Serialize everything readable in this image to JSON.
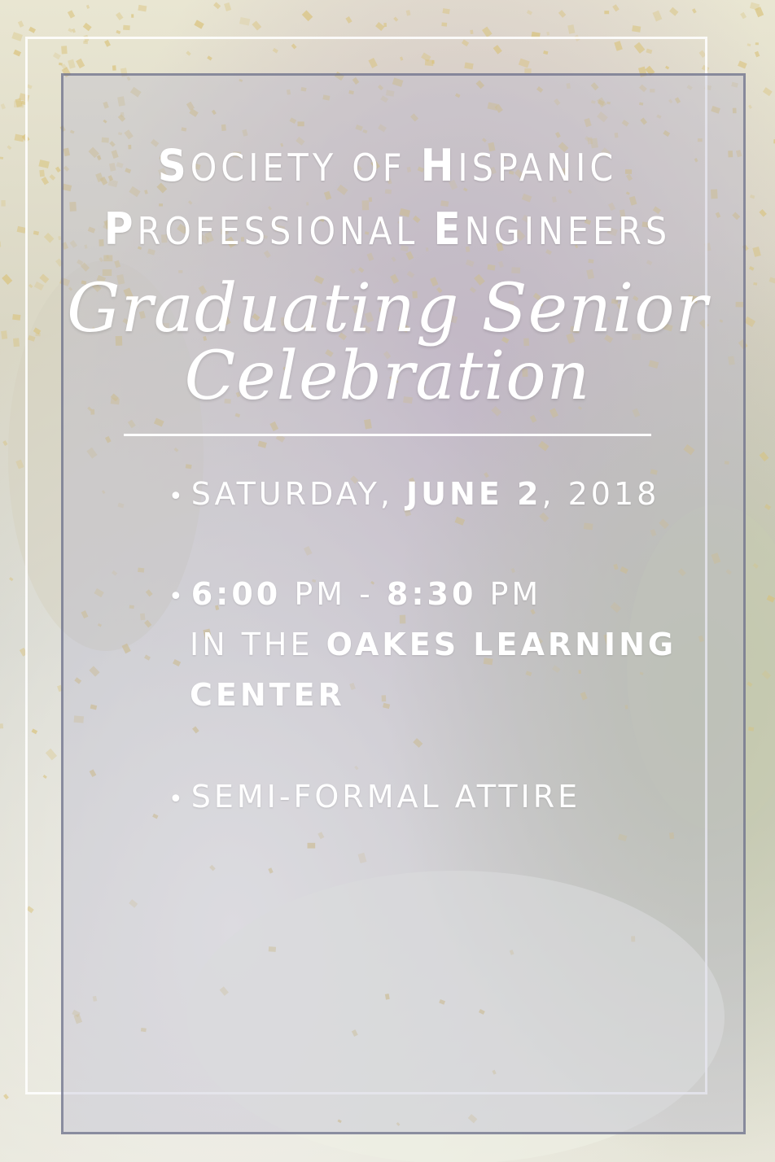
{
  "header": {
    "line1": [
      {
        "text": "S",
        "big": true
      },
      {
        "text": "OCIETY OF ",
        "big": false
      },
      {
        "text": "H",
        "big": true
      },
      {
        "text": "ISPANIC",
        "big": false
      }
    ],
    "line2": [
      {
        "text": "P",
        "big": true
      },
      {
        "text": "ROFESSIONAL ",
        "big": false
      },
      {
        "text": "E",
        "big": true
      },
      {
        "text": "NGINEERS",
        "big": false
      }
    ]
  },
  "script_title": {
    "line1": "Graduating Senior",
    "line2": "Celebration"
  },
  "details": {
    "bullet": "•",
    "date_prefix": "SATURDAY, ",
    "date_bold": "JUNE 2",
    "date_suffix": ", 2018",
    "time_start": "6:00",
    "time_start_pm": " PM - ",
    "time_end": "8:30",
    "time_end_pm": " PM",
    "location_prefix": "IN THE ",
    "location_bold_1": "OAKES LEARNING",
    "location_bold_2": "CENTER",
    "attire": "SEMI-FORMAL ATTIRE"
  },
  "colors": {
    "text": "#ffffff",
    "overlay": "#b2b4cd",
    "inner_border": "#606480",
    "confetti": "#d9c27a"
  }
}
